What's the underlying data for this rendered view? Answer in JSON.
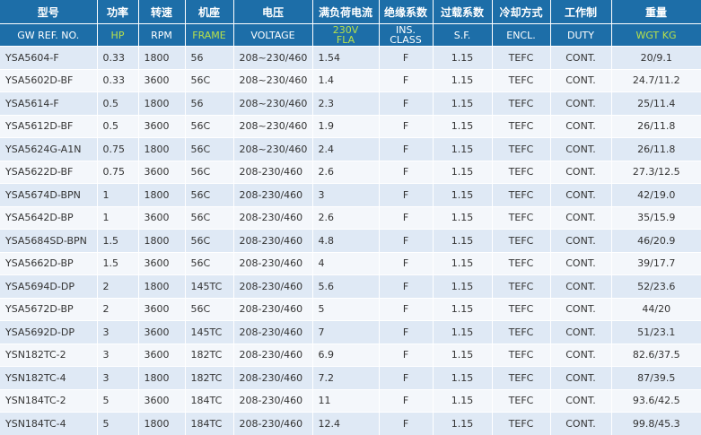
{
  "header_zh": [
    "型号",
    "功率",
    "转速",
    "机座",
    "电压",
    "满负荷电流",
    "绝缘系数",
    "过载系数",
    "冷却方式",
    "工作制",
    "重量"
  ],
  "header_en": [
    {
      "line1": "GW REF. NO.",
      "line2": "",
      "green": false
    },
    {
      "line1": "HP",
      "line2": "",
      "green": true
    },
    {
      "line1": "RPM",
      "line2": "",
      "green": false
    },
    {
      "line1": "FRAME",
      "line2": "",
      "green": true
    },
    {
      "line1": "VOLTAGE",
      "line2": "",
      "green": false
    },
    {
      "line1": "230V",
      "line2": "FLA",
      "green": true
    },
    {
      "line1": "INS.",
      "line2": "CLASS",
      "green": false
    },
    {
      "line1": "S.F.",
      "line2": "",
      "green": false
    },
    {
      "line1": "ENCL.",
      "line2": "",
      "green": false
    },
    {
      "line1": "DUTY",
      "line2": "",
      "green": false
    },
    {
      "line1": "WGT KG",
      "line2": "",
      "green": true
    }
  ],
  "rows": [
    [
      "YSA5604-F",
      "0.33",
      "1800",
      "56",
      "208~230/460",
      "1.54",
      "F",
      "1.15",
      "TEFC",
      "CONT.",
      "20/9.1"
    ],
    [
      "YSA5602D-BF",
      "0.33",
      "3600",
      "56C",
      "208~230/460",
      "1.4",
      "F",
      "1.15",
      "TEFC",
      "CONT.",
      "24.7/11.2"
    ],
    [
      "YSA5614-F",
      "0.5",
      "1800",
      "56",
      "208~230/460",
      "2.3",
      "F",
      "1.15",
      "TEFC",
      "CONT.",
      "25/11.4"
    ],
    [
      "YSA5612D-BF",
      "0.5",
      "3600",
      "56C",
      "208~230/460",
      "1.9",
      "F",
      "1.15",
      "TEFC",
      "CONT.",
      "26/11.8"
    ],
    [
      "YSA5624G-A1N",
      "0.75",
      "1800",
      "56C",
      "208~230/460",
      "2.4",
      "F",
      "1.15",
      "TEFC",
      "CONT.",
      "26/11.8"
    ],
    [
      "YSA5622D-BF",
      "0.75",
      "3600",
      "56C",
      "208-230/460",
      "2.6",
      "F",
      "1.15",
      "TEFC",
      "CONT.",
      "27.3/12.5"
    ],
    [
      "YSA5674D-BPN",
      "1",
      "1800",
      "56C",
      "208-230/460",
      "3",
      "F",
      "1.15",
      "TEFC",
      "CONT.",
      "42/19.0"
    ],
    [
      "YSA5642D-BP",
      "1",
      "3600",
      "56C",
      "208-230/460",
      "2.6",
      "F",
      "1.15",
      "TEFC",
      "CONT.",
      "35/15.9"
    ],
    [
      "YSA5684SD-BPN",
      "1.5",
      "1800",
      "56C",
      "208-230/460",
      "4.8",
      "F",
      "1.15",
      "TEFC",
      "CONT.",
      "46/20.9"
    ],
    [
      "YSA5662D-BP",
      "1.5",
      "3600",
      "56C",
      "208-230/460",
      "4",
      "F",
      "1.15",
      "TEFC",
      "CONT.",
      "39/17.7"
    ],
    [
      "YSA5694D-DP",
      "2",
      "1800",
      "145TC",
      "208-230/460",
      "5.6",
      "F",
      "1.15",
      "TEFC",
      "CONT.",
      "52/23.6"
    ],
    [
      "YSA5672D-BP",
      "2",
      "3600",
      "56C",
      "208-230/460",
      "5",
      "F",
      "1.15",
      "TEFC",
      "CONT.",
      "44/20"
    ],
    [
      "YSA5692D-DP",
      "3",
      "3600",
      "145TC",
      "208-230/460",
      "7",
      "F",
      "1.15",
      "TEFC",
      "CONT.",
      "51/23.1"
    ],
    [
      "YSN182TC-2",
      "3",
      "3600",
      "182TC",
      "208-230/460",
      "6.9",
      "F",
      "1.15",
      "TEFC",
      "CONT.",
      "82.6/37.5"
    ],
    [
      "YSN182TC-4",
      "3",
      "1800",
      "182TC",
      "208-230/460",
      "7.2",
      "F",
      "1.15",
      "TEFC",
      "CONT.",
      "87/39.5"
    ],
    [
      "YSN184TC-2",
      "5",
      "3600",
      "184TC",
      "208-230/460",
      "11",
      "F",
      "1.15",
      "TEFC",
      "CONT.",
      "93.6/42.5"
    ],
    [
      "YSN184TC-4",
      "5",
      "1800",
      "184TC",
      "208-230/460",
      "12.4",
      "F",
      "1.15",
      "TEFC",
      "CONT.",
      "99.8/45.3"
    ]
  ]
}
